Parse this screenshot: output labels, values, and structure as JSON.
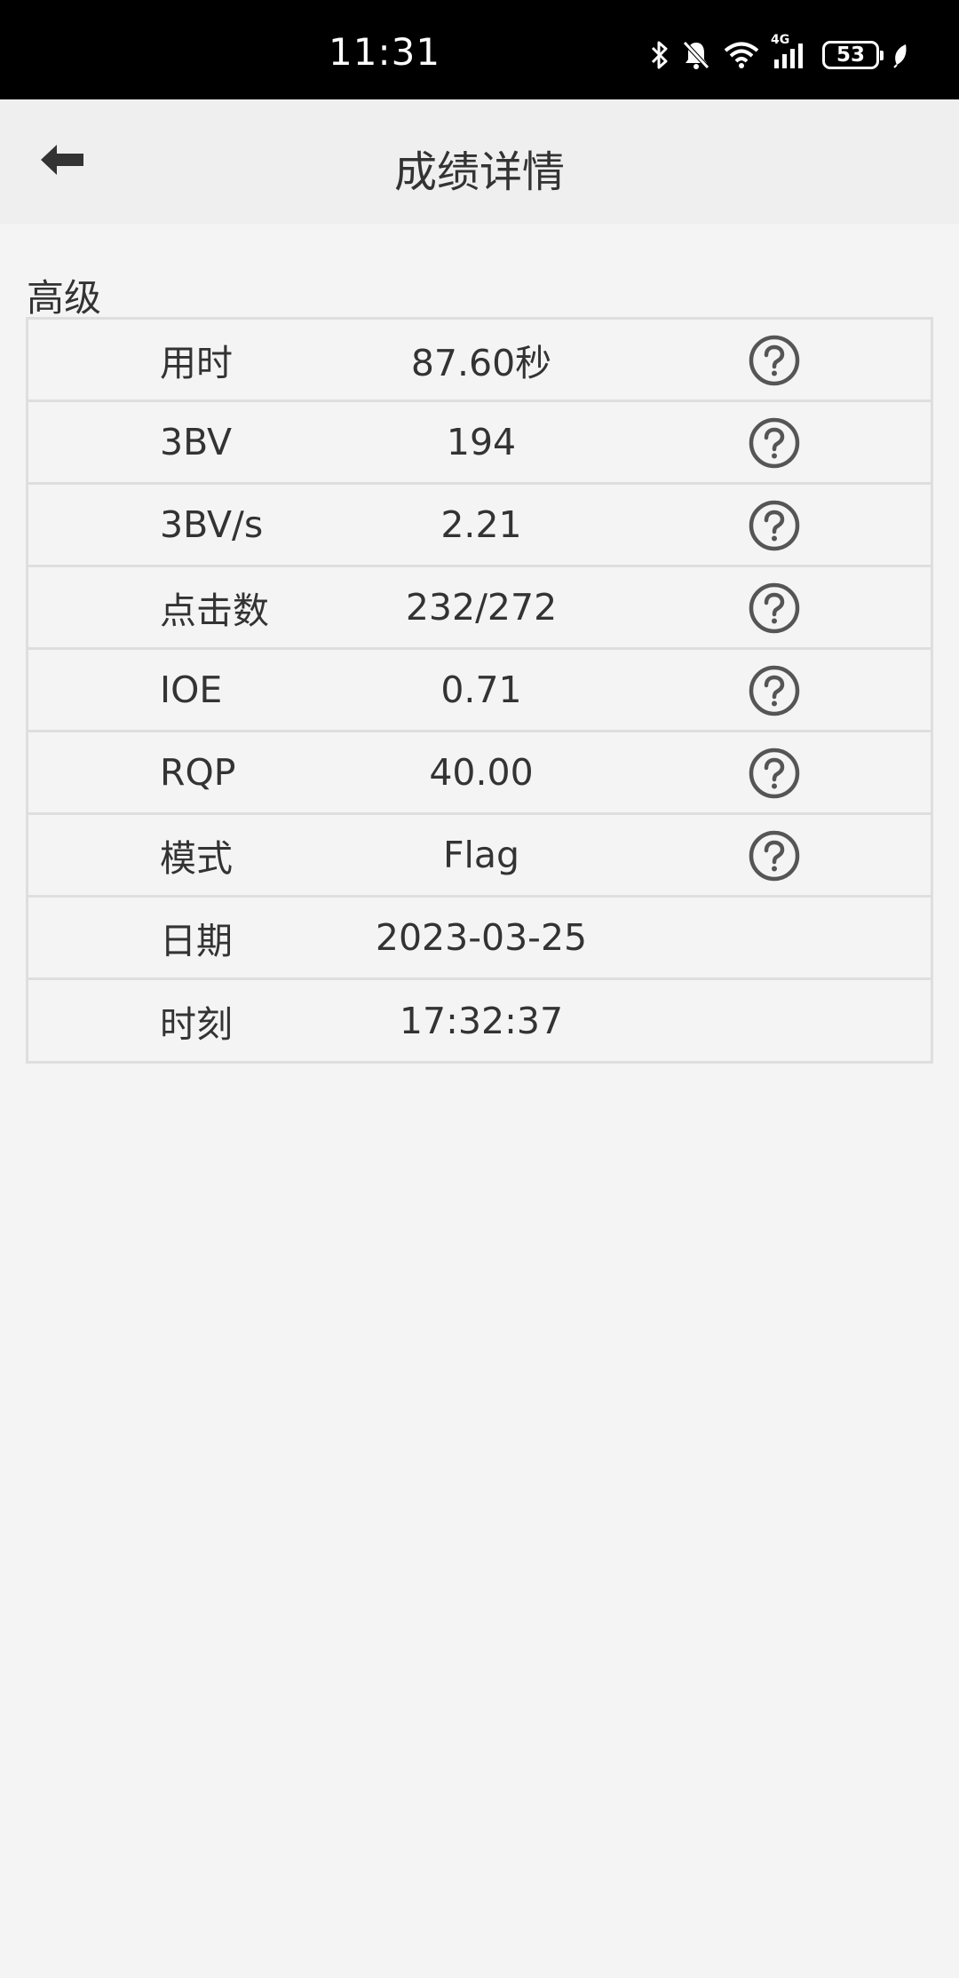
{
  "status_bar": {
    "time": "11:31",
    "battery": "53",
    "network": "4G",
    "icons": [
      "bluetooth-icon",
      "bell-off-icon",
      "wifi-icon",
      "signal-icon",
      "battery-icon",
      "leaf-icon"
    ]
  },
  "app_bar": {
    "back_icon": "arrow-left-icon",
    "title": "成绩详情"
  },
  "section": {
    "title": "高级"
  },
  "stats": [
    {
      "label": "用时",
      "value": "87.60秒",
      "help": true
    },
    {
      "label": "3BV",
      "value": "194",
      "help": true
    },
    {
      "label": "3BV/s",
      "value": "2.21",
      "help": true
    },
    {
      "label": "点击数",
      "value": "232/272",
      "help": true
    },
    {
      "label": "IOE",
      "value": "0.71",
      "help": true
    },
    {
      "label": "RQP",
      "value": "40.00",
      "help": true
    },
    {
      "label": "模式",
      "value": "Flag",
      "help": true
    },
    {
      "label": "日期",
      "value": "2023-03-25",
      "help": false
    },
    {
      "label": "时刻",
      "value": "17:32:37",
      "help": false
    }
  ],
  "colors": {
    "status_bar_bg": "#000000",
    "app_bar_bg": "#efefef",
    "page_bg": "#f4f4f4",
    "border": "#dedede",
    "text": "#333333",
    "help_icon": "#555555"
  }
}
